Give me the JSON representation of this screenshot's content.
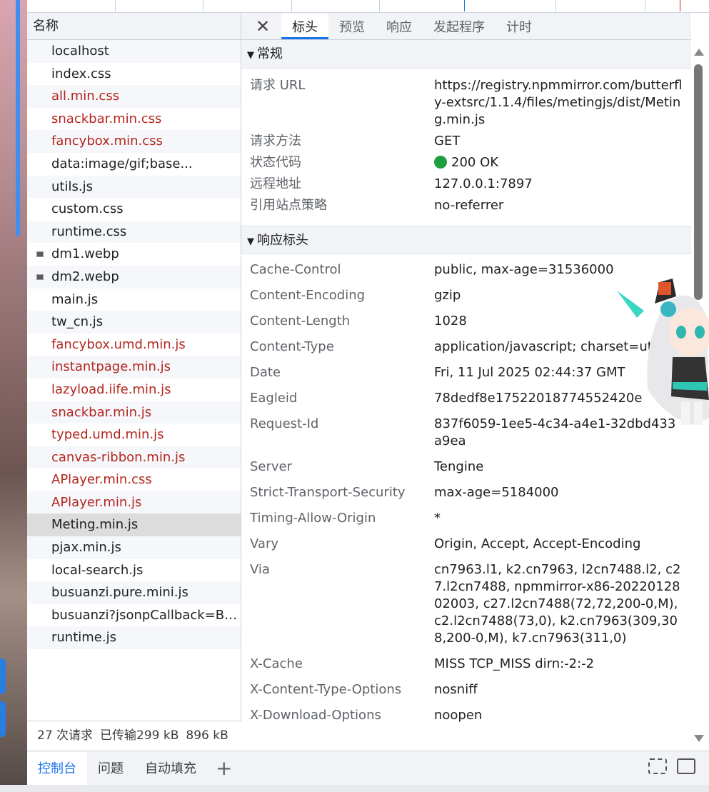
{
  "request_list": {
    "header": "名称",
    "rows": [
      {
        "name": "localhost",
        "error": false,
        "selected": false,
        "thumb": false
      },
      {
        "name": "index.css",
        "error": false,
        "selected": false,
        "thumb": false
      },
      {
        "name": "all.min.css",
        "error": true,
        "selected": false,
        "thumb": false
      },
      {
        "name": "snackbar.min.css",
        "error": true,
        "selected": false,
        "thumb": false
      },
      {
        "name": "fancybox.min.css",
        "error": true,
        "selected": false,
        "thumb": false
      },
      {
        "name": "data:image/gif;base...",
        "error": false,
        "selected": false,
        "thumb": false
      },
      {
        "name": "utils.js",
        "error": false,
        "selected": false,
        "thumb": false
      },
      {
        "name": "custom.css",
        "error": false,
        "selected": false,
        "thumb": false
      },
      {
        "name": "runtime.css",
        "error": false,
        "selected": false,
        "thumb": false
      },
      {
        "name": "dm1.webp",
        "error": false,
        "selected": false,
        "thumb": true
      },
      {
        "name": "dm2.webp",
        "error": false,
        "selected": false,
        "thumb": true
      },
      {
        "name": "main.js",
        "error": false,
        "selected": false,
        "thumb": false
      },
      {
        "name": "tw_cn.js",
        "error": false,
        "selected": false,
        "thumb": false
      },
      {
        "name": "fancybox.umd.min.js",
        "error": true,
        "selected": false,
        "thumb": false
      },
      {
        "name": "instantpage.min.js",
        "error": true,
        "selected": false,
        "thumb": false
      },
      {
        "name": "lazyload.iife.min.js",
        "error": true,
        "selected": false,
        "thumb": false
      },
      {
        "name": "snackbar.min.js",
        "error": true,
        "selected": false,
        "thumb": false
      },
      {
        "name": "typed.umd.min.js",
        "error": true,
        "selected": false,
        "thumb": false
      },
      {
        "name": "canvas-ribbon.min.js",
        "error": true,
        "selected": false,
        "thumb": false
      },
      {
        "name": "APlayer.min.css",
        "error": true,
        "selected": false,
        "thumb": false
      },
      {
        "name": "APlayer.min.js",
        "error": true,
        "selected": false,
        "thumb": false
      },
      {
        "name": "Meting.min.js",
        "error": false,
        "selected": true,
        "thumb": false
      },
      {
        "name": "pjax.min.js",
        "error": false,
        "selected": false,
        "thumb": false
      },
      {
        "name": "local-search.js",
        "error": false,
        "selected": false,
        "thumb": false
      },
      {
        "name": "busuanzi.pure.mini.js",
        "error": false,
        "selected": false,
        "thumb": false
      },
      {
        "name": "busuanzi?jsonpCallback=Bu...",
        "error": false,
        "selected": false,
        "thumb": false
      },
      {
        "name": "runtime.js",
        "error": false,
        "selected": false,
        "thumb": false
      }
    ],
    "summary": {
      "requests": "27 次请求",
      "transferred": "已传输299 kB",
      "resources": "896 kB"
    }
  },
  "details": {
    "tabs": [
      "标头",
      "预览",
      "响应",
      "发起程序",
      "计时"
    ],
    "active_tab": "标头",
    "general": {
      "title": "常规",
      "rows": [
        {
          "key": "请求 URL",
          "value": "https://registry.npmmirror.com/butterfly-extsrc/1.1.4/files/metingjs/dist/Meting.min.js"
        },
        {
          "key": "请求方法",
          "value": "GET"
        },
        {
          "key": "状态代码",
          "value": "200 OK"
        },
        {
          "key": "远程地址",
          "value": "127.0.0.1:7897"
        },
        {
          "key": "引用站点策略",
          "value": "no-referrer"
        }
      ]
    },
    "response_headers": {
      "title": "响应标头",
      "rows": [
        {
          "key": "Cache-Control",
          "value": "public, max-age=31536000"
        },
        {
          "key": "Content-Encoding",
          "value": "gzip"
        },
        {
          "key": "Content-Length",
          "value": "1028"
        },
        {
          "key": "Content-Type",
          "value": "application/javascript; charset=utf-8"
        },
        {
          "key": "Date",
          "value": "Fri, 11 Jul 2025 02:44:37 GMT"
        },
        {
          "key": "Eagleid",
          "value": "78dedf8e17522018774552420e"
        },
        {
          "key": "Request-Id",
          "value": "837f6059-1ee5-4c34-a4e1-32dbd433a9ea"
        },
        {
          "key": "Server",
          "value": "Tengine"
        },
        {
          "key": "Strict-Transport-Security",
          "value": "max-age=5184000"
        },
        {
          "key": "Timing-Allow-Origin",
          "value": "*"
        },
        {
          "key": "Vary",
          "value": "Origin, Accept, Accept-Encoding"
        },
        {
          "key": "Via",
          "value": "cn7963.l1, k2.cn7963, l2cn7488.l2, c27.l2cn7488, npmmirror-x86-2022012802003, c27.l2cn7488(72,72,200-0,M), c2.l2cn7488(73,0), k2.cn7963(309,308,200-0,M), k7.cn7963(311,0)"
        },
        {
          "key": "X-Cache",
          "value": "MISS TCP_MISS dirn:-2:-2"
        },
        {
          "key": "X-Content-Type-Options",
          "value": "nosniff"
        },
        {
          "key": "X-Download-Options",
          "value": "noopen"
        }
      ]
    }
  },
  "drawer": {
    "tabs": [
      "控制台",
      "问题",
      "自动填充"
    ],
    "active_tab": "控制台",
    "add_icon": "plus-icon",
    "right_icons": [
      "dock-icon",
      "screenshot-icon"
    ]
  },
  "colors": {
    "error_text": "#b3261e",
    "accent": "#1a73e8",
    "status_ok": "#1e9e3e",
    "selected_row": "#dcdcdc"
  }
}
